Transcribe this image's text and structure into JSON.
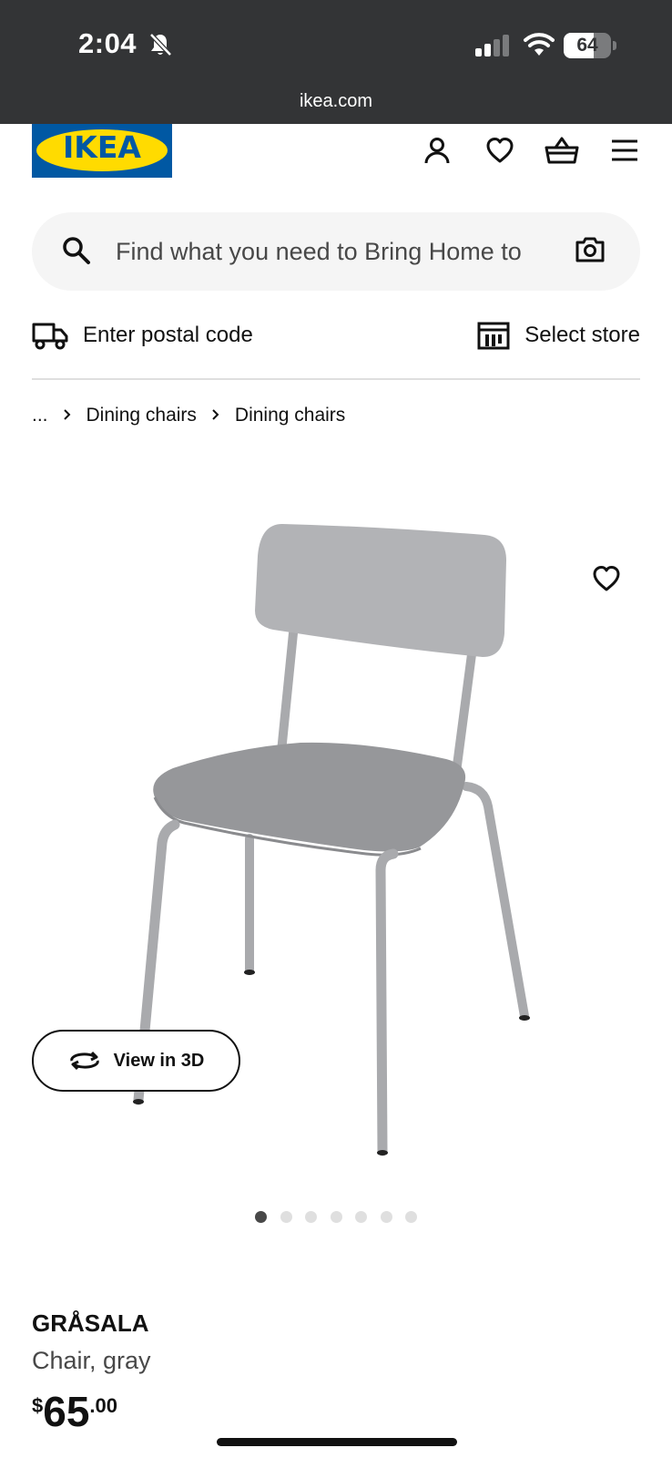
{
  "status_bar": {
    "time": "2:04",
    "battery": "64",
    "url": "ikea.com",
    "icons": [
      "bell-slash-icon",
      "signal-icon",
      "wifi-icon",
      "battery-icon"
    ]
  },
  "header": {
    "logo_text": "IKEA",
    "icons": [
      "account-icon",
      "heart-icon",
      "shopping-basket-icon",
      "menu-icon"
    ],
    "brand_colors": {
      "blue": "#0058a3",
      "yellow": "#ffdb00"
    }
  },
  "search": {
    "placeholder": "Find what you need to Bring Home to"
  },
  "delivery": {
    "postal_label": "Enter postal code",
    "store_label": "Select store"
  },
  "breadcrumb": {
    "items": [
      "...",
      "Dining chairs",
      "Dining chairs"
    ]
  },
  "gallery": {
    "view_3d_label": "View in 3D",
    "image_count": 7,
    "active_index": 1
  },
  "product": {
    "name": "GRÅSALA",
    "description": "Chair, gray",
    "price_currency": "$",
    "price_main": "65",
    "price_decimal": ".00"
  }
}
